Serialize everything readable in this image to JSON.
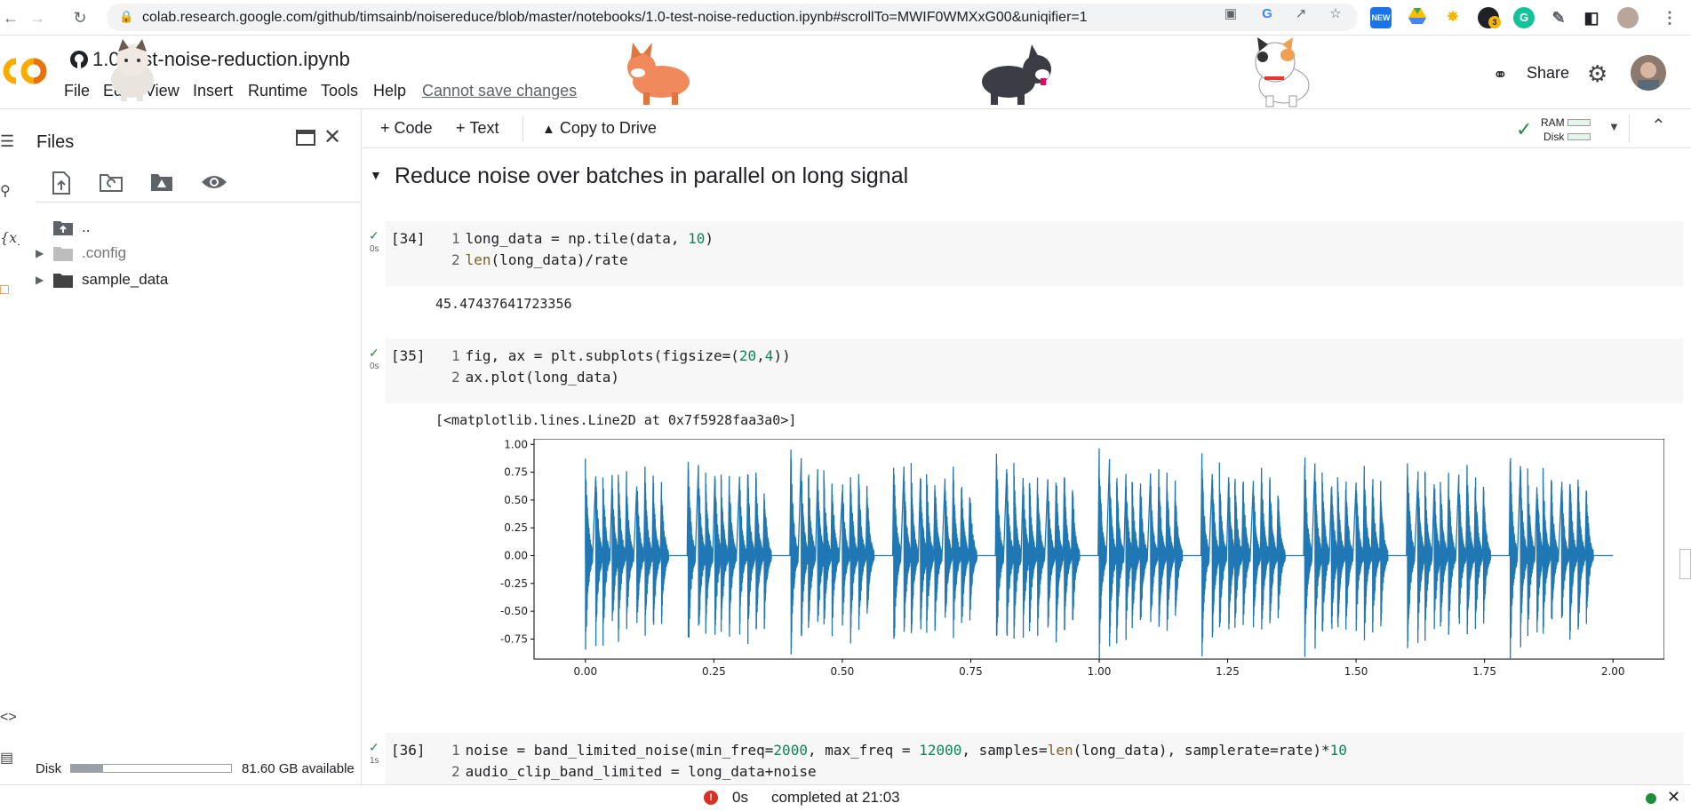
{
  "browser": {
    "url": "colab.research.google.com/github/timsainb/noisereduce/blob/master/notebooks/1.0-test-noise-reduction.ipynb#scrollTo=MWIF0WMXxG00&uniqifier=1",
    "back_icon": "arrow-left-icon",
    "forward_icon": "arrow-right-icon",
    "reload_icon": "reload-icon",
    "extension_badge": "3"
  },
  "header": {
    "title": "1.0-test-noise-reduction.ipynb",
    "menu": [
      "File",
      "Edit",
      "View",
      "Insert",
      "Runtime",
      "Tools",
      "Help"
    ],
    "cannot_save": "Cannot save changes",
    "share_label": "Share",
    "logo_text": "CO"
  },
  "files_panel": {
    "title": "Files",
    "tree": [
      {
        "name": "..",
        "expandable": false
      },
      {
        "name": ".config",
        "expandable": true,
        "dim": true
      },
      {
        "name": "sample_data",
        "expandable": true,
        "dim": false
      }
    ],
    "disk_label": "Disk",
    "disk_used_fraction": 0.2,
    "disk_available": "81.60 GB available"
  },
  "toolbar": {
    "code_label": "Code",
    "text_label": "Text",
    "copy_label": "Copy to Drive",
    "ram_label": "RAM",
    "disk_label": "Disk"
  },
  "notebook": {
    "section_title": "Reduce noise over batches in parallel on long signal",
    "cells": [
      {
        "number": "[34]",
        "time": "0s",
        "lines": [
          {
            "n": "1",
            "parts": [
              [
                "",
                "long_data = np.tile(data, "
              ],
              [
                "num",
                "10"
              ],
              [
                "",
                ")"
              ]
            ]
          },
          {
            "n": "2",
            "parts": [
              [
                "fn",
                "len"
              ],
              [
                "",
                "(long_data)/rate"
              ]
            ]
          }
        ],
        "output": "45.47437641723356"
      },
      {
        "number": "[35]",
        "time": "0s",
        "lines": [
          {
            "n": "1",
            "parts": [
              [
                "",
                "fig, ax = plt.subplots(figsize=("
              ],
              [
                "num",
                "20"
              ],
              [
                "",
                ","
              ],
              [
                "num",
                "4"
              ],
              [
                "",
                "))"
              ]
            ]
          },
          {
            "n": "2",
            "parts": [
              [
                "",
                "ax.plot(long_data)"
              ]
            ]
          }
        ],
        "output": "[<matplotlib.lines.Line2D at 0x7f5928faa3a0>]"
      },
      {
        "number": "[36]",
        "time": "1s",
        "lines": [
          {
            "n": "1",
            "parts": [
              [
                "",
                "noise = band_limited_noise(min_freq="
              ],
              [
                "num",
                "2000"
              ],
              [
                "",
                ", max_freq = "
              ],
              [
                "num",
                "12000"
              ],
              [
                "",
                ", samples="
              ],
              [
                "fn",
                "len"
              ],
              [
                "",
                "(long_data), samplerate=rate)*"
              ],
              [
                "num",
                "10"
              ]
            ]
          },
          {
            "n": "2",
            "parts": [
              [
                "",
                "audio_clip_band_limited = long_data+noise"
              ]
            ]
          }
        ]
      }
    ]
  },
  "chart_data": {
    "type": "line",
    "yticks": [
      "1.00",
      "0.75",
      "0.50",
      "0.25",
      "0.00",
      "-0.25",
      "-0.50",
      "-0.75"
    ],
    "xticks": [
      "0.00",
      "0.25",
      "0.50",
      "0.75",
      "1.00",
      "1.25",
      "1.50",
      "1.75",
      "2.00"
    ],
    "x_scale_label": "1e6",
    "xlim": [
      -100000,
      2100000
    ],
    "ylim": [
      -0.93,
      1.05
    ],
    "line_color": "#1f77b4",
    "repeats": 10,
    "repeat_length": 200000,
    "signal_end": 2000000
  },
  "status": {
    "time": "0s",
    "message": "completed at 21:03",
    "error_badge": "!"
  }
}
